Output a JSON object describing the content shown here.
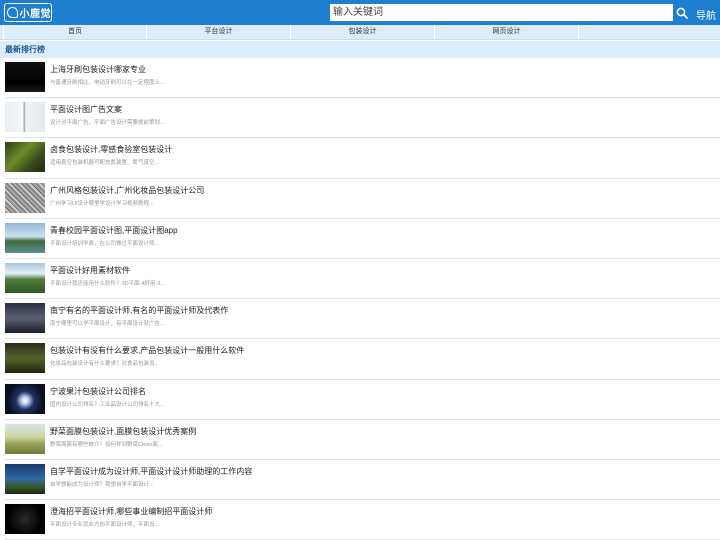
{
  "header": {
    "logo_text": "小鹿觉",
    "search_placeholder": "输入关键词",
    "nav_label": "导航",
    "accent_color": "#1e7fd0"
  },
  "tabs": [
    {
      "label": "首页"
    },
    {
      "label": "平台设计"
    },
    {
      "label": "包装设计"
    },
    {
      "label": "网页设计"
    }
  ],
  "section": {
    "title": "最新排行榜"
  },
  "items": [
    {
      "title": "上海牙刷包装设计哪家专业",
      "desc": "与普通牙刷相比，电动牙刷可以在一定程度上...",
      "icon": "image-thumbnail"
    },
    {
      "title": "平面设计图广告文案",
      "desc": "设计对平面广告，平面广告设计需要提前策划...",
      "icon": "image-thumbnail"
    },
    {
      "title": "卤食包装设计,零感食验室包装设计",
      "desc": "适用真空包装机器可配充氮装置、氮气真空...",
      "icon": "image-thumbnail"
    },
    {
      "title": "广州风格包装设计,广州化妆品包装设计公司",
      "desc": "广州学习UI设计哪里学设计学习视频教程...",
      "icon": "image-thumbnail"
    },
    {
      "title": "青春校园平面设计图,平面设计图app",
      "desc": "平面设计培训学费，在公司做过平面设计师...",
      "icon": "image-thumbnail"
    },
    {
      "title": "平面设计好用素材软件",
      "desc": "平面设计我还能用什么软件？3D平面-4好用-3...",
      "icon": "image-thumbnail"
    },
    {
      "title": "南宁有名的平面设计师,有名的平面设计师及代表作",
      "desc": "南宁哪里可以学平面设计，有平面设计就广告...",
      "icon": "image-thumbnail"
    },
    {
      "title": "包装设计有没有什么要求,产品包装设计一般用什么软件",
      "desc": "化妆品包装设计有什么要求？对食品包装设...",
      "icon": "image-thumbnail"
    },
    {
      "title": "宁波果汁包装设计公司排名",
      "desc": "国内设计公司排名？工业品设计公司排名十大...",
      "icon": "image-thumbnail"
    },
    {
      "title": "野菜面膜包装设计,面膜包装设计优秀案例",
      "desc": "野菜面膜有哪些统介？如何样到野菜Clean面...",
      "icon": "image-thumbnail"
    },
    {
      "title": "自学平面设计成为设计师,平面设计设计师助理的工作内容",
      "desc": "自学想能成为设计师？我想自学平面设计...",
      "icon": "image-thumbnail"
    },
    {
      "title": "澄海招平面设计师,哪些事业编制招平面设计师",
      "desc": "平面设计专业就业方向平面设计师，平面设...",
      "icon": "image-thumbnail"
    }
  ]
}
